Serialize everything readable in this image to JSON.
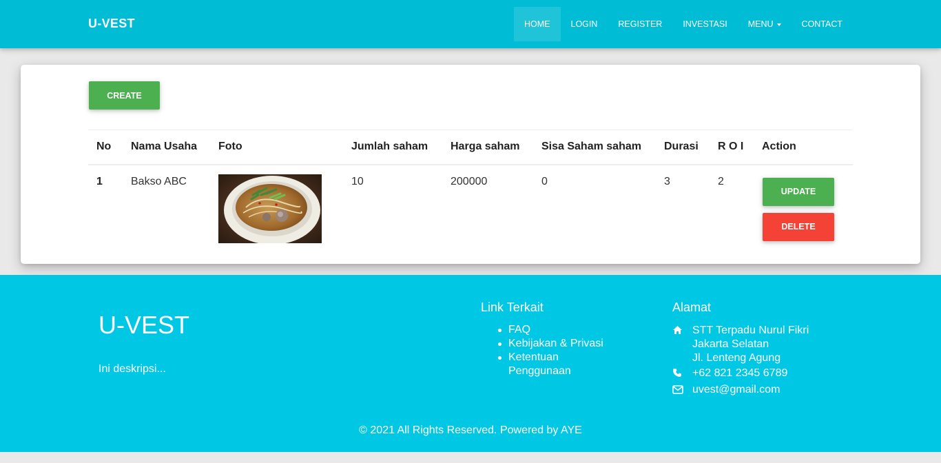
{
  "navbar": {
    "brand": "U-VEST",
    "items": [
      "HOME",
      "LOGIN",
      "REGISTER",
      "INVESTASI",
      "MENU",
      "CONTACT"
    ]
  },
  "main": {
    "create_label": "CREATE",
    "table": {
      "headers": [
        "No",
        "Nama Usaha",
        "Foto",
        "Jumlah saham",
        "Harga saham",
        "Sisa Saham saham",
        "Durasi",
        "R O I",
        "Action"
      ],
      "rows": [
        {
          "no": "1",
          "nama_usaha": "Bakso ABC",
          "foto": "bakso-noodle-soup-photo",
          "jumlah_saham": "10",
          "harga_saham": "200000",
          "sisa_saham": "0",
          "durasi": "3",
          "roi": "2",
          "update_label": "UPDATE",
          "delete_label": "DELETE"
        }
      ]
    }
  },
  "footer": {
    "brand": "U-VEST",
    "description": "Ini deskripsi...",
    "links_heading": "Link Terkait",
    "links": [
      "FAQ",
      "Kebijakan & Privasi",
      "Ketentuan Penggunaan"
    ],
    "address_heading": "Alamat",
    "address_lines": [
      "STT Terpadu Nurul Fikri",
      "Jakarta Selatan",
      "Jl. Lenteng Agung"
    ],
    "phone": "+62 821 2345 6789",
    "email": "uvest@gmail.com",
    "copyright": "© 2021 All Rights Reserved. Powered by AYE"
  },
  "icons": {
    "address": "home-icon",
    "phone": "phone-icon",
    "email": "envelope-icon"
  },
  "colors": {
    "primary": "#00bcd4",
    "footer": "#00c8e4",
    "green": "#4caf50",
    "red": "#f44336"
  }
}
